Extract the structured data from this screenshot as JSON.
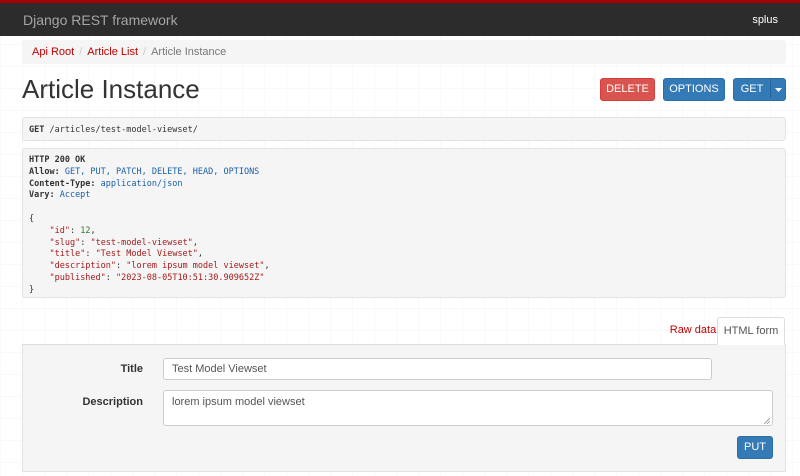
{
  "navbar": {
    "brand": "Django REST framework",
    "user": "splus"
  },
  "breadcrumb": {
    "items": [
      {
        "label": "Api Root",
        "link": true
      },
      {
        "label": "Article List",
        "link": true
      },
      {
        "label": "Article Instance",
        "link": false
      }
    ],
    "separator": "/"
  },
  "page_title": "Article Instance",
  "actions": {
    "delete": "DELETE",
    "options": "OPTIONS",
    "get": "GET"
  },
  "request": {
    "method": "GET",
    "path": " /articles/test-model-viewset/"
  },
  "response": {
    "status": "HTTP 200 OK",
    "headers": [
      {
        "name": "Allow:",
        "value": " GET, PUT, PATCH, DELETE, HEAD, OPTIONS"
      },
      {
        "name": "Content-Type:",
        "value": " application/json"
      },
      {
        "name": "Vary:",
        "value": " Accept"
      }
    ],
    "body_open": "{",
    "fields": [
      {
        "key": "\"id\"",
        "value": "12",
        "type": "number"
      },
      {
        "key": "\"slug\"",
        "value": "\"test-model-viewset\"",
        "type": "string"
      },
      {
        "key": "\"title\"",
        "value": "\"Test Model Viewset\"",
        "type": "string"
      },
      {
        "key": "\"description\"",
        "value": "\"lorem ipsum model viewset\"",
        "type": "string"
      },
      {
        "key": "\"published\"",
        "value": "\"2023-08-05T10:51:30.909652Z\"",
        "type": "string"
      }
    ],
    "body_close": "}"
  },
  "tabs": {
    "raw": "Raw data",
    "html": "HTML form"
  },
  "form": {
    "title_label": "Title",
    "title_value": "Test Model Viewset",
    "description_label": "Description",
    "description_value": "lorem ipsum model viewset",
    "submit": "PUT"
  },
  "colors": {
    "navbar_bg": "#2c2c2c",
    "navbar_accent": "#a40000",
    "link": "#c20000",
    "danger": "#d9534f",
    "primary": "#337ab7"
  },
  "icons": {
    "get_dropdown": "caret-down-icon"
  }
}
